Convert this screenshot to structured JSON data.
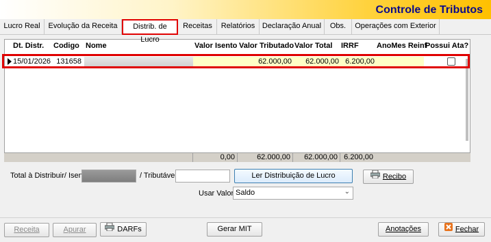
{
  "app": {
    "title": "Controle de Tributos"
  },
  "tabs": [
    {
      "label": "Lucro Real"
    },
    {
      "label": "Evolução da Receita"
    },
    {
      "label": "Distrib. de Lucro"
    },
    {
      "label": "Receitas"
    },
    {
      "label": "Relatórios"
    },
    {
      "label": "Declaração Anual"
    },
    {
      "label": "Obs."
    },
    {
      "label": "Operações com Exterior"
    }
  ],
  "grid": {
    "headers": [
      "Dt. Distr.",
      "Codigo",
      "Nome",
      "Valor Isento",
      "Valor Tributado",
      "Valor Total",
      "IRRF",
      "AnoMes Reinf",
      "Possui Ata?"
    ],
    "row": {
      "dt_distr": "15/01/2026",
      "codigo": "131658",
      "nome": "",
      "valor_isento": "",
      "valor_tributado": "62.000,00",
      "valor_total": "62.000,00",
      "irrf": "6.200,00",
      "anomes_reinf": "",
      "possui_ata": false
    },
    "totals": {
      "valor_isento": "0,00",
      "valor_tributado": "62.000,00",
      "valor_total": "62.000,00",
      "irrf": "6.200,00"
    }
  },
  "form": {
    "total_label": "Total à Distribuir/ Isento",
    "tributavel_label": "/ Tributável",
    "ler_button": "Ler Distribuição de Lucro",
    "recibo_button": "Recibo",
    "usar_valor_label": "Usar Valor",
    "usar_valor_selected": "Saldo"
  },
  "footer": {
    "receita": "Receita",
    "apurar": "Apurar",
    "darfs": "DARFs",
    "gerar_mit": "Gerar MIT",
    "anotacoes": "Anotações",
    "fechar": "Fechar"
  }
}
